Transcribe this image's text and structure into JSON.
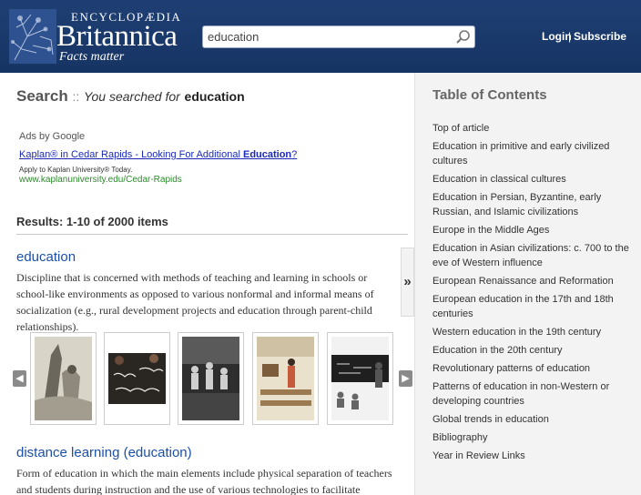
{
  "header": {
    "brand_top": "ENCYCLOPÆDIA",
    "brand_name": "Britannica",
    "tagline": "Facts matter",
    "search_value": "education",
    "login": "Login",
    "separator": "|",
    "subscribe": "Subscribe"
  },
  "search_heading": {
    "word": "Search",
    "colons": "::",
    "you_searched": "You searched for",
    "query": "education"
  },
  "ads": {
    "label": "Ads by Google",
    "link_prefix": "Kaplan® in Cedar Rapids - Looking For Additional",
    "link_bold": "Education",
    "link_suffix": "?",
    "sub": "Apply to Kaplan University® Today.",
    "url": "www.kaplanuniversity.edu/Cedar-Rapids"
  },
  "results": {
    "count_label": "Results: 1-10 of 2000 items",
    "items": [
      {
        "title": "education",
        "description": "Discipline that is concerned with methods of teaching and learning in schools or school-like environments as opposed to various nonformal and informal means of socialization (e.g., rural development projects and education through parent-child relationships)."
      },
      {
        "title": "distance learning (education)",
        "description": "Form of education in which the main elements include physical separation of teachers and students during instruction and the use of various technologies to facilitate student-teacher and student-student"
      }
    ]
  },
  "carousel": {
    "prev": "◀",
    "next": "▶"
  },
  "expand_label": "»",
  "toc": {
    "title": "Table of Contents",
    "items": [
      "Top of article",
      "Education in primitive and early civilized cultures",
      "Education in classical cultures",
      "Education in Persian, Byzantine, early Russian, and Islamic civilizations",
      "Europe in the Middle Ages",
      "Education in Asian civilizations: c. 700 to the eve of Western influence",
      "European Renaissance and Reformation",
      "European education in the 17th and 18th centuries",
      "Western education in the 19th century",
      "Education in the 20th century",
      "Revolutionary patterns of education",
      "Patterns of education in non-Western or developing countries",
      "Global trends in education",
      "Bibliography",
      "Year in Review Links"
    ]
  },
  "colors": {
    "header": "#1f3f74",
    "link": "#1a4faa",
    "sidebar": "#f3f3f3"
  }
}
